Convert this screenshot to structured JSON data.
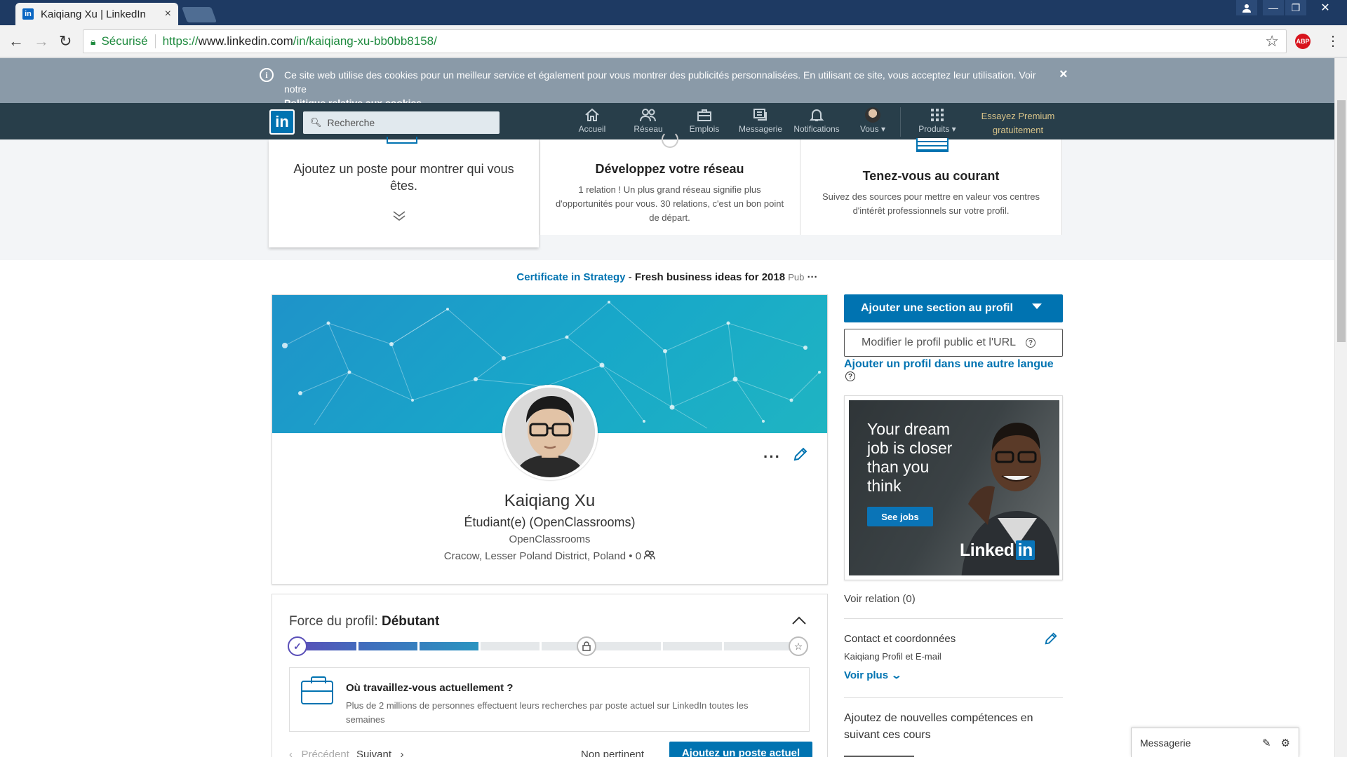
{
  "browser": {
    "tab_title": "Kaiqiang Xu | LinkedIn",
    "tab_favicon": "in",
    "tab_close": "×",
    "secure_label": "Sécurisé",
    "url_prefix": "https://",
    "url_host": "www.linkedin.com",
    "url_path": "/in/kaiqiang-xu-bb0bb8158/",
    "abp_label": "ABP"
  },
  "cookie": {
    "text": "Ce site web utilise des cookies pour un meilleur service et également pour vous montrer des publicités personnalisées. En utilisant ce site, vous acceptez leur utilisation. Voir notre",
    "link": "Politique relative aux cookies",
    "close": "×"
  },
  "header": {
    "logo": "in",
    "search_placeholder": "Recherche",
    "nav": [
      {
        "label": "Accueil",
        "icon": "home-icon"
      },
      {
        "label": "Réseau",
        "icon": "network-icon"
      },
      {
        "label": "Emplois",
        "icon": "jobs-icon"
      },
      {
        "label": "Messagerie",
        "icon": "messaging-icon"
      },
      {
        "label": "Notifications",
        "icon": "bell-icon"
      },
      {
        "label": "Vous ▾",
        "icon": "avatar"
      },
      {
        "label": "Produits ▾",
        "icon": "grid-icon"
      }
    ],
    "premium_line1": "Essayez Premium",
    "premium_line2": "gratuitement"
  },
  "cards": {
    "post_text": "Ajoutez un poste pour montrer qui vous êtes.",
    "network_title": "Développez votre réseau",
    "network_desc": "1 relation ! Un plus grand réseau signifie plus d'opportunités pour vous. 30 relations, c'est un bon point de départ.",
    "news_title": "Tenez-vous au courant",
    "news_desc": "Suivez des sources pour mettre en valeur vos centres d'intérêt professionnels sur votre profil."
  },
  "ad_line": {
    "link": "Certificate in Strategy",
    "sep": " - ",
    "title": "Fresh business ideas for 2018",
    "pub": "Pub",
    "more": "···"
  },
  "profile": {
    "name": "Kaiqiang Xu",
    "headline": "Étudiant(e) (OpenClassrooms)",
    "company": "OpenClassrooms",
    "location": "Cracow, Lesser Poland District, Poland",
    "connections": "0",
    "more": "···"
  },
  "strength": {
    "label": "Force du profil: ",
    "level": "Débutant",
    "progress_fraction": 0.36,
    "suggestion_title": "Où travaillez-vous actuellement ?",
    "suggestion_desc": "Plus de 2 millions de personnes effectuent leurs recherches par poste actuel sur LinkedIn toutes les semaines",
    "prev": "Précédent",
    "next": "Suivant",
    "skip": "Non pertinent",
    "add": "Ajoutez un poste actuel"
  },
  "rail": {
    "add_section": "Ajouter une section au profil",
    "edit_public": "Modifier le profil public et l'URL",
    "other_language": "Ajouter un profil dans une autre langue",
    "ad_headline": "Your dream job is closer than you think",
    "ad_button": "See jobs",
    "ad_logo": "Linked",
    "ad_logo_in": "in",
    "see_connections": "Voir relation (0)",
    "contact_title": "Contact et coordonnées",
    "contact_sub": "Kaiqiang Profil et E-mail",
    "see_more": "Voir plus",
    "courses_title": "Ajoutez de nouvelles compétences en suivant ces cours"
  },
  "messaging": {
    "label": "Messagerie"
  },
  "colors": {
    "linkedin_blue": "#0073b1",
    "header_bg": "#283e4a",
    "cookie_bg": "#8a9aa8",
    "chrome_titlebar": "#1e3a63"
  }
}
